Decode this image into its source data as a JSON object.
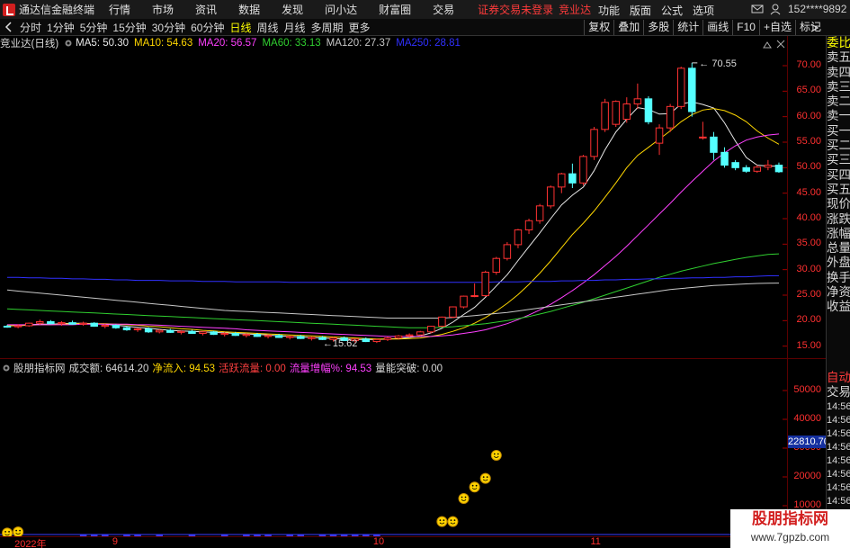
{
  "titlebar": {
    "app_title": "通达信金融终端",
    "menu": [
      "行情",
      "市场",
      "资讯",
      "数据",
      "发现",
      "问小达",
      "财富圈",
      "交易"
    ],
    "notice": "证券交易未登录",
    "stock": "竞业达",
    "right_menu": [
      "功能",
      "版面",
      "公式",
      "选项"
    ],
    "user": "152****9892"
  },
  "periods": [
    "分时",
    "1分钟",
    "5分钟",
    "15分钟",
    "30分钟",
    "60分钟",
    "日线",
    "周线",
    "月线",
    "多周期",
    "更多"
  ],
  "active_period": "日线",
  "toolbar_right": [
    "复权",
    "叠加",
    "多股",
    "统计",
    "画线",
    "F10",
    "+自选",
    "标记"
  ],
  "main_header": {
    "name": "竞业达(日线)",
    "ma": [
      {
        "label": "MA5: 50.30",
        "color": "#e8e8e8"
      },
      {
        "label": "MA10: 54.63",
        "color": "#ffd700"
      },
      {
        "label": "MA20: 56.57",
        "color": "#ff40ff"
      },
      {
        "label": "MA60: 33.13",
        "color": "#30d030"
      },
      {
        "label": "MA120: 27.37",
        "color": "#c8c8c8"
      },
      {
        "label": "MA250: 28.81",
        "color": "#3030ff"
      }
    ]
  },
  "price_axis": [
    "70.00",
    "65.00",
    "60.00",
    "55.00",
    "50.00",
    "45.00",
    "40.00",
    "35.00",
    "30.00",
    "25.00",
    "20.00",
    "15.00"
  ],
  "annotations": {
    "high": "70.55",
    "low": "15.62"
  },
  "side_tabs": [
    "委比",
    "卖五",
    "卖四",
    "卖三",
    "卖二",
    "卖一",
    "买一",
    "买二",
    "买三",
    "买四",
    "买五",
    "现价",
    "涨跌",
    "涨幅",
    "总量",
    "外盘",
    "换手",
    "净资",
    "收益"
  ],
  "side_tabs_lower": [
    "自动",
    "交易",
    "14:56",
    "14:56",
    "14:56",
    "14:56",
    "14:56",
    "14:56",
    "14:56",
    "14:56",
    "14:56",
    "14:56"
  ],
  "indicator_header": {
    "name": "股朋指标网",
    "items": [
      {
        "label": "成交额: 64614.20",
        "color": "#d8d8d8"
      },
      {
        "label": "净流入: 94.53",
        "color": "#ffd700"
      },
      {
        "label": "活跃流量: 0.00",
        "color": "#ff4040"
      },
      {
        "label": "流量增幅%: 94.53",
        "color": "#ff40ff"
      },
      {
        "label": "量能突破: 0.00",
        "color": "#d8d8d8"
      }
    ]
  },
  "volume_axis": [
    "50000",
    "40000",
    "30000",
    "20000",
    "10000"
  ],
  "current_value_box": "22810.70",
  "x_axis": [
    "2022年",
    "9",
    "10",
    "11"
  ],
  "watermark": {
    "line1": "股朋指标网",
    "line2": "www.7gpzb.com"
  },
  "chart_data": {
    "type": "candlestick",
    "title": "竞业达(日线)",
    "ylim": [
      13,
      73
    ],
    "candles": [
      [
        18.9,
        19.2,
        18.6,
        18.8
      ],
      [
        18.8,
        19.3,
        18.5,
        19.0
      ],
      [
        19.0,
        19.6,
        18.8,
        19.5
      ],
      [
        19.5,
        20.2,
        19.2,
        19.8
      ],
      [
        19.8,
        20.1,
        19.3,
        19.4
      ],
      [
        19.4,
        19.9,
        19.0,
        19.6
      ],
      [
        19.6,
        20.0,
        19.2,
        19.3
      ],
      [
        19.3,
        19.8,
        19.0,
        19.5
      ],
      [
        19.5,
        19.7,
        18.8,
        18.9
      ],
      [
        18.9,
        19.4,
        18.5,
        19.1
      ],
      [
        19.1,
        19.3,
        18.4,
        18.6
      ],
      [
        18.6,
        18.9,
        18.0,
        18.2
      ],
      [
        18.2,
        18.6,
        17.8,
        18.4
      ],
      [
        18.4,
        18.7,
        17.6,
        17.8
      ],
      [
        17.8,
        18.3,
        17.5,
        18.1
      ],
      [
        18.1,
        18.4,
        17.6,
        17.7
      ],
      [
        17.7,
        18.1,
        17.3,
        17.9
      ],
      [
        17.9,
        18.2,
        17.4,
        17.5
      ],
      [
        17.5,
        17.9,
        17.1,
        17.8
      ],
      [
        17.8,
        18.0,
        17.2,
        17.3
      ],
      [
        17.3,
        17.7,
        16.9,
        17.5
      ],
      [
        17.5,
        17.8,
        17.0,
        17.1
      ],
      [
        17.1,
        17.5,
        16.7,
        17.3
      ],
      [
        17.3,
        17.6,
        16.8,
        16.9
      ],
      [
        16.9,
        17.3,
        16.5,
        17.1
      ],
      [
        17.1,
        17.4,
        16.6,
        16.7
      ],
      [
        16.7,
        17.1,
        16.3,
        16.9
      ],
      [
        16.9,
        17.2,
        16.4,
        16.5
      ],
      [
        16.5,
        16.9,
        16.1,
        16.7
      ],
      [
        16.7,
        17.0,
        16.2,
        16.3
      ],
      [
        16.3,
        16.8,
        15.9,
        16.6
      ],
      [
        16.6,
        16.9,
        16.0,
        16.1
      ],
      [
        16.1,
        16.5,
        15.7,
        16.4
      ],
      [
        16.4,
        16.7,
        15.8,
        15.9
      ],
      [
        15.9,
        16.4,
        15.62,
        16.3
      ],
      [
        16.3,
        16.8,
        16.0,
        16.6
      ],
      [
        16.6,
        17.2,
        16.3,
        17.0
      ],
      [
        17.0,
        17.5,
        16.7,
        17.2
      ],
      [
        17.2,
        18.0,
        17.0,
        17.8
      ],
      [
        17.8,
        19.0,
        17.5,
        18.9
      ],
      [
        18.9,
        20.8,
        18.7,
        20.7
      ],
      [
        20.7,
        22.8,
        20.5,
        22.7
      ],
      [
        22.7,
        24.9,
        22.4,
        24.8
      ],
      [
        24.8,
        27.3,
        24.6,
        24.9
      ],
      [
        24.9,
        29.8,
        24.7,
        29.5
      ],
      [
        29.5,
        32.5,
        29.0,
        32.2
      ],
      [
        32.2,
        35.4,
        31.8,
        34.9
      ],
      [
        34.9,
        38.0,
        34.2,
        37.8
      ],
      [
        37.8,
        40.0,
        37.0,
        39.6
      ],
      [
        39.6,
        42.9,
        39.0,
        42.5
      ],
      [
        42.5,
        46.5,
        42.0,
        46.2
      ],
      [
        46.2,
        49.0,
        45.0,
        48.8
      ],
      [
        48.8,
        50.8,
        46.0,
        47.0
      ],
      [
        47.0,
        52.5,
        46.5,
        52.2
      ],
      [
        52.2,
        58.0,
        51.5,
        57.5
      ],
      [
        57.5,
        63.5,
        57.0,
        62.8
      ],
      [
        58.5,
        63.2,
        58.0,
        63.0
      ],
      [
        59.5,
        63.8,
        58.8,
        62.5
      ],
      [
        62.5,
        66.5,
        61.5,
        63.5
      ],
      [
        63.5,
        64.0,
        58.5,
        59.0
      ],
      [
        54.8,
        58.5,
        52.5,
        57.8
      ],
      [
        57.8,
        62.5,
        57.0,
        62.0
      ],
      [
        62.0,
        69.8,
        61.5,
        69.5
      ],
      [
        69.5,
        70.55,
        60.0,
        61.0
      ],
      [
        56.0,
        59.0,
        55.5,
        56.0
      ],
      [
        56.0,
        57.0,
        51.5,
        53.0
      ],
      [
        53.0,
        54.0,
        50.0,
        50.5
      ],
      [
        51.0,
        51.5,
        49.5,
        50.0
      ],
      [
        50.0,
        50.5,
        49.0,
        49.3
      ],
      [
        49.3,
        50.5,
        49.0,
        50.1
      ],
      [
        50.1,
        51.5,
        49.5,
        50.5
      ],
      [
        50.5,
        51.0,
        49.0,
        49.2
      ]
    ],
    "ma_series": [
      {
        "name": "MA5",
        "color": "#e8e8e8",
        "values": [
          19.0,
          19.1,
          19.2,
          19.3,
          19.3,
          19.4,
          19.5,
          19.5,
          19.4,
          19.3,
          19.1,
          18.9,
          18.7,
          18.5,
          18.3,
          18.1,
          18.0,
          17.9,
          17.8,
          17.7,
          17.6,
          17.5,
          17.4,
          17.3,
          17.2,
          17.0,
          16.9,
          16.8,
          16.7,
          16.6,
          16.5,
          16.4,
          16.3,
          16.3,
          16.3,
          16.4,
          16.5,
          16.7,
          17.0,
          17.6,
          18.5,
          19.7,
          21.2,
          22.6,
          24.6,
          26.8,
          29.0,
          31.8,
          34.5,
          37.2,
          40.0,
          42.7,
          44.6,
          46.2,
          49.4,
          53.5,
          57.0,
          59.5,
          61.8,
          61.4,
          60.5,
          60.6,
          62.5,
          62.9,
          62.4,
          61.7,
          58.8,
          55.2,
          52.0,
          50.5,
          50.3,
          50.3
        ]
      },
      {
        "name": "MA10",
        "color": "#ffd700",
        "values": [
          19.0,
          19.0,
          19.1,
          19.2,
          19.2,
          19.3,
          19.4,
          19.4,
          19.4,
          19.4,
          19.3,
          19.2,
          19.1,
          18.9,
          18.8,
          18.6,
          18.4,
          18.3,
          18.1,
          18.0,
          17.8,
          17.7,
          17.6,
          17.5,
          17.4,
          17.3,
          17.2,
          17.1,
          17.0,
          16.9,
          16.8,
          16.7,
          16.6,
          16.5,
          16.4,
          16.4,
          16.4,
          16.5,
          16.6,
          16.9,
          17.3,
          17.9,
          18.6,
          19.5,
          20.6,
          21.9,
          23.4,
          25.1,
          27.1,
          29.3,
          31.7,
          34.3,
          36.9,
          39.1,
          41.5,
          44.2,
          47.0,
          50.0,
          52.4,
          54.0,
          55.6,
          57.2,
          59.0,
          60.4,
          61.3,
          61.6,
          61.2,
          60.3,
          59.0,
          57.2,
          55.8,
          54.6
        ]
      },
      {
        "name": "MA20",
        "color": "#ff40ff",
        "values": [
          19.2,
          19.2,
          19.2,
          19.2,
          19.2,
          19.2,
          19.2,
          19.3,
          19.3,
          19.3,
          19.3,
          19.3,
          19.2,
          19.2,
          19.1,
          19.0,
          18.9,
          18.8,
          18.7,
          18.6,
          18.5,
          18.4,
          18.2,
          18.1,
          18.0,
          17.9,
          17.8,
          17.7,
          17.6,
          17.5,
          17.4,
          17.3,
          17.2,
          17.1,
          17.0,
          16.9,
          16.9,
          16.9,
          16.9,
          16.9,
          17.0,
          17.2,
          17.5,
          17.8,
          18.2,
          18.8,
          19.4,
          20.2,
          21.1,
          22.1,
          23.2,
          24.5,
          25.9,
          27.4,
          29.0,
          30.8,
          32.6,
          34.6,
          36.7,
          38.8,
          40.9,
          43.0,
          45.2,
          47.3,
          49.3,
          51.3,
          52.9,
          54.3,
          55.4,
          56.0,
          56.4,
          56.6
        ]
      },
      {
        "name": "MA60",
        "color": "#30d030",
        "values": [
          22.3,
          22.2,
          22.1,
          22.0,
          21.9,
          21.8,
          21.7,
          21.6,
          21.5,
          21.4,
          21.3,
          21.2,
          21.1,
          21.0,
          20.9,
          20.8,
          20.7,
          20.6,
          20.5,
          20.4,
          20.3,
          20.2,
          20.1,
          20.0,
          19.9,
          19.8,
          19.7,
          19.6,
          19.5,
          19.4,
          19.3,
          19.2,
          19.1,
          19.0,
          18.9,
          18.8,
          18.7,
          18.6,
          18.6,
          18.6,
          18.7,
          18.8,
          19.0,
          19.2,
          19.4,
          19.7,
          20.0,
          20.4,
          20.8,
          21.3,
          21.8,
          22.4,
          23.0,
          23.6,
          24.3,
          25.0,
          25.7,
          26.4,
          27.1,
          27.8,
          28.5,
          29.1,
          29.7,
          30.2,
          30.7,
          31.2,
          31.6,
          32.0,
          32.4,
          32.7,
          33.0,
          33.1
        ]
      },
      {
        "name": "MA120",
        "color": "#c8c8c8",
        "values": [
          26.0,
          25.8,
          25.6,
          25.4,
          25.2,
          25.0,
          24.8,
          24.6,
          24.4,
          24.2,
          24.0,
          23.8,
          23.6,
          23.4,
          23.2,
          23.0,
          22.8,
          22.6,
          22.4,
          22.2,
          22.0,
          21.9,
          21.8,
          21.7,
          21.6,
          21.5,
          21.4,
          21.3,
          21.2,
          21.1,
          21.0,
          20.9,
          20.8,
          20.7,
          20.6,
          20.5,
          20.5,
          20.5,
          20.5,
          20.5,
          20.5,
          20.6,
          20.8,
          21.0,
          21.2,
          21.4,
          21.6,
          21.9,
          22.2,
          22.5,
          22.8,
          23.1,
          23.4,
          23.7,
          24.0,
          24.3,
          24.6,
          24.9,
          25.2,
          25.5,
          25.8,
          26.1,
          26.3,
          26.5,
          26.7,
          26.9,
          27.0,
          27.1,
          27.2,
          27.3,
          27.35,
          27.37
        ]
      },
      {
        "name": "MA250",
        "color": "#3030ff",
        "values": [
          28.5,
          28.5,
          28.4,
          28.4,
          28.3,
          28.3,
          28.2,
          28.2,
          28.1,
          28.1,
          28.0,
          28.0,
          27.9,
          27.9,
          27.9,
          27.8,
          27.8,
          27.8,
          27.7,
          27.7,
          27.7,
          27.6,
          27.6,
          27.6,
          27.6,
          27.6,
          27.5,
          27.5,
          27.5,
          27.5,
          27.5,
          27.5,
          27.5,
          27.5,
          27.5,
          27.5,
          27.5,
          27.5,
          27.5,
          27.5,
          27.5,
          27.5,
          27.5,
          27.5,
          27.5,
          27.6,
          27.6,
          27.6,
          27.7,
          27.7,
          27.7,
          27.8,
          27.8,
          27.9,
          27.9,
          28.0,
          28.0,
          28.1,
          28.1,
          28.2,
          28.2,
          28.3,
          28.3,
          28.4,
          28.4,
          28.5,
          28.5,
          28.6,
          28.6,
          28.7,
          28.8,
          28.81
        ]
      }
    ],
    "volume_ylim": [
      0,
      55000
    ],
    "net_inflow_markers": [
      {
        "index": 0,
        "value": 500
      },
      {
        "index": 1,
        "value": 900
      },
      {
        "index": 40,
        "value": 4500
      },
      {
        "index": 41,
        "value": 4500
      },
      {
        "index": 42,
        "value": 12500
      },
      {
        "index": 43,
        "value": 16500
      },
      {
        "index": 44,
        "value": 19500
      },
      {
        "index": 45,
        "value": 27500
      }
    ],
    "volume_bars": [
      0,
      0,
      0,
      0,
      0,
      0,
      0,
      -800,
      -800,
      -800,
      0,
      -800,
      -800,
      0,
      -800,
      0,
      0,
      -800,
      0,
      0,
      -800,
      0,
      -800,
      -800,
      -800,
      0,
      -800,
      -800,
      0,
      -800,
      -800,
      -800,
      -800,
      -800,
      -800,
      0,
      0,
      0,
      0,
      0,
      0,
      0,
      0,
      0,
      0,
      0,
      0,
      0,
      0,
      0,
      0,
      0,
      0,
      0,
      0,
      0,
      0,
      0,
      0,
      0,
      0,
      0,
      0,
      0,
      0,
      0,
      0,
      0,
      0,
      -1600,
      -3400,
      0
    ]
  }
}
